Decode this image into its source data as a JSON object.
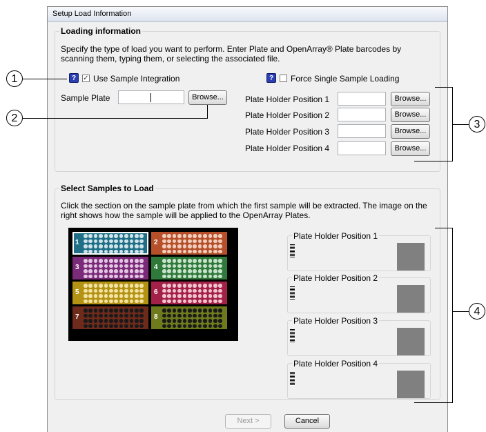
{
  "dialog": {
    "title": "Setup Load Information"
  },
  "loading": {
    "group_label": "Loading information",
    "description": "Specify the type of load you want to perform. Enter Plate and OpenArray® Plate barcodes by scanning them, typing them, or selecting the associated file.",
    "help_label": "?",
    "use_sample_integration": "Use Sample Integration",
    "use_sample_integration_checked": true,
    "force_single": "Force Single Sample Loading",
    "force_single_checked": false,
    "sample_plate_label": "Sample Plate",
    "sample_plate_value": "",
    "browse_label": "Browse...",
    "positions": [
      {
        "label": "Plate Holder Position 1",
        "value": ""
      },
      {
        "label": "Plate Holder Position 2",
        "value": ""
      },
      {
        "label": "Plate Holder Position 3",
        "value": ""
      },
      {
        "label": "Plate Holder Position 4",
        "value": ""
      }
    ]
  },
  "select": {
    "group_label": "Select Samples to Load",
    "description": "Click the section on the sample plate from which the first sample will be extracted. The image on the right shows how the sample will be applied to the OpenArray Plates.",
    "sections": [
      {
        "num": "1",
        "color": "#1f6f86",
        "well": "#cfe3ea"
      },
      {
        "num": "2",
        "color": "#b5502a",
        "well": "#f1cdbd"
      },
      {
        "num": "3",
        "color": "#7a2a79",
        "well": "#e2c6e2"
      },
      {
        "num": "4",
        "color": "#2f7a3a",
        "well": "#c8e3cc"
      },
      {
        "num": "5",
        "color": "#b39214",
        "well": "#f2e3a4"
      },
      {
        "num": "6",
        "color": "#a32047",
        "well": "#f0c3d0"
      },
      {
        "num": "7",
        "color": "#6e2a1a",
        "well": "#1a1a1a"
      },
      {
        "num": "8",
        "color": "#6f7a1c",
        "well": "#1a1a1a"
      }
    ],
    "holders": [
      {
        "label": "Plate Holder Position 1"
      },
      {
        "label": "Plate Holder Position 2"
      },
      {
        "label": "Plate Holder Position 3"
      },
      {
        "label": "Plate Holder Position 4"
      }
    ]
  },
  "footer": {
    "next_label": "Next >",
    "cancel_label": "Cancel"
  },
  "callouts": [
    "1",
    "2",
    "3",
    "4"
  ]
}
